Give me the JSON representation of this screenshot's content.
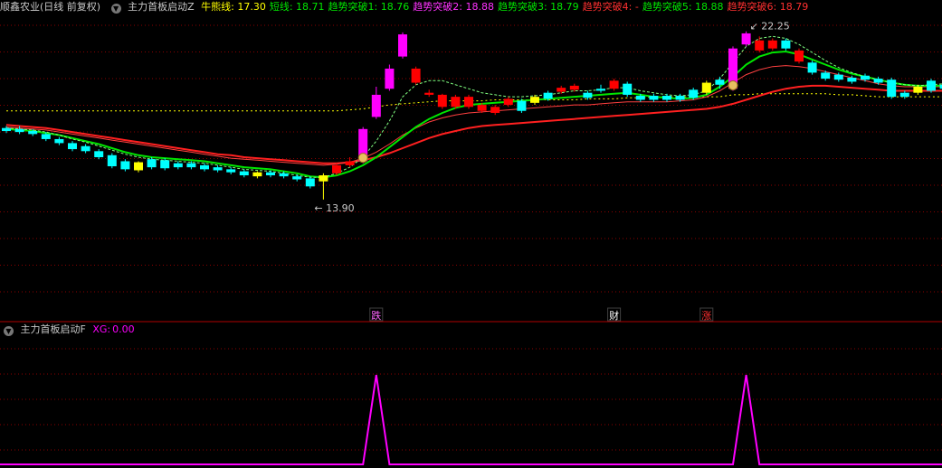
{
  "main_panel": {
    "stock": "顺鑫农业(日线 前复权)",
    "indicator": "主力首板启动Z",
    "values": [
      {
        "label": "牛熊线:",
        "value": "17.30",
        "color": "#ffff00"
      },
      {
        "label": "短线:",
        "value": "18.71",
        "color": "#00e600"
      },
      {
        "label": "趋势突破1:",
        "value": "18.76",
        "color": "#00e600"
      },
      {
        "label": "趋势突破2:",
        "value": "18.88",
        "color": "#ff33ff"
      },
      {
        "label": "趋势突破3:",
        "value": "18.79",
        "color": "#00e600"
      },
      {
        "label": "趋势突破4:",
        "value": "-",
        "color": "#ff3030"
      },
      {
        "label": "趋势突破5:",
        "value": "18.88",
        "color": "#00e600"
      },
      {
        "label": "趋势突破6:",
        "value": "18.79",
        "color": "#ff3030"
      }
    ]
  },
  "sub_panel": {
    "indicator": "主力首板启动F",
    "xg_label": "XG:",
    "xg_value": "0.00"
  },
  "annotations": {
    "low": "13.90",
    "high": "22.25",
    "signals": [
      {
        "text": "跌",
        "bar": 28,
        "color": "#ff66ff"
      },
      {
        "text": "财",
        "bar": 46,
        "color": "#ffffff"
      },
      {
        "text": "涨",
        "bar": 53,
        "color": "#ff3030"
      }
    ]
  },
  "colors": {
    "up_red": "#ff0000",
    "down_cyan": "#00ffff",
    "magenta": "#ff00ff",
    "yellow": "#ffff00",
    "green_line": "#00e600",
    "red_line": "#ff2020",
    "grid": "#8b0000"
  },
  "chart_data": {
    "type": "candlestick",
    "price_range": [
      9.0,
      23.0
    ],
    "candles": [
      {
        "o": 17.45,
        "h": 17.55,
        "c": 17.3,
        "l": 17.2,
        "k": "d"
      },
      {
        "o": 17.4,
        "h": 17.55,
        "c": 17.25,
        "l": 17.15,
        "k": "d"
      },
      {
        "o": 17.3,
        "h": 17.4,
        "c": 17.15,
        "l": 17.05,
        "k": "d"
      },
      {
        "o": 17.15,
        "h": 17.25,
        "c": 16.9,
        "l": 16.8,
        "k": "d"
      },
      {
        "o": 16.9,
        "h": 17.0,
        "c": 16.7,
        "l": 16.6,
        "k": "d"
      },
      {
        "o": 16.7,
        "h": 16.8,
        "c": 16.4,
        "l": 16.3,
        "k": "d"
      },
      {
        "o": 16.55,
        "h": 16.65,
        "c": 16.3,
        "l": 16.2,
        "k": "d"
      },
      {
        "o": 16.3,
        "h": 16.4,
        "c": 16.0,
        "l": 15.9,
        "k": "d"
      },
      {
        "o": 16.1,
        "h": 16.2,
        "c": 15.55,
        "l": 15.45,
        "k": "d"
      },
      {
        "o": 15.8,
        "h": 15.9,
        "c": 15.4,
        "l": 15.3,
        "k": "d"
      },
      {
        "o": 15.35,
        "h": 15.8,
        "c": 15.75,
        "l": 15.25,
        "k": "y"
      },
      {
        "o": 15.9,
        "h": 16.0,
        "c": 15.5,
        "l": 15.4,
        "k": "d"
      },
      {
        "o": 15.85,
        "h": 15.95,
        "c": 15.45,
        "l": 15.35,
        "k": "d"
      },
      {
        "o": 15.7,
        "h": 15.8,
        "c": 15.5,
        "l": 15.4,
        "k": "d"
      },
      {
        "o": 15.7,
        "h": 15.8,
        "c": 15.5,
        "l": 15.4,
        "k": "d"
      },
      {
        "o": 15.6,
        "h": 15.7,
        "c": 15.4,
        "l": 15.3,
        "k": "d"
      },
      {
        "o": 15.5,
        "h": 15.6,
        "c": 15.35,
        "l": 15.25,
        "k": "d"
      },
      {
        "o": 15.4,
        "h": 15.5,
        "c": 15.25,
        "l": 15.15,
        "k": "d"
      },
      {
        "o": 15.3,
        "h": 15.4,
        "c": 15.1,
        "l": 15.0,
        "k": "d"
      },
      {
        "o": 15.05,
        "h": 15.3,
        "c": 15.25,
        "l": 14.95,
        "k": "y"
      },
      {
        "o": 15.25,
        "h": 15.35,
        "c": 15.1,
        "l": 15.0,
        "k": "d"
      },
      {
        "o": 15.2,
        "h": 15.3,
        "c": 15.05,
        "l": 14.95,
        "k": "d"
      },
      {
        "o": 15.05,
        "h": 15.15,
        "c": 14.9,
        "l": 14.8,
        "k": "d"
      },
      {
        "o": 14.95,
        "h": 15.05,
        "c": 14.55,
        "l": 14.45,
        "k": "d"
      },
      {
        "o": 14.8,
        "h": 15.2,
        "c": 15.1,
        "l": 13.9,
        "k": "y"
      },
      {
        "o": 15.2,
        "h": 15.7,
        "c": 15.6,
        "l": 15.1,
        "k": "u"
      },
      {
        "o": 15.6,
        "h": 16.0,
        "c": 15.8,
        "l": 15.5,
        "k": "u"
      },
      {
        "o": 15.8,
        "h": 17.5,
        "c": 17.4,
        "l": 15.7,
        "k": "m"
      },
      {
        "o": 18.0,
        "h": 19.5,
        "c": 19.1,
        "l": 17.9,
        "k": "m"
      },
      {
        "o": 19.4,
        "h": 20.6,
        "c": 20.4,
        "l": 19.3,
        "k": "m"
      },
      {
        "o": 21.0,
        "h": 22.2,
        "c": 22.1,
        "l": 20.9,
        "k": "m"
      },
      {
        "o": 20.4,
        "h": 20.5,
        "c": 19.7,
        "l": 19.6,
        "k": "u"
      },
      {
        "o": 19.2,
        "h": 19.35,
        "c": 19.1,
        "l": 19.0,
        "k": "u"
      },
      {
        "o": 19.1,
        "h": 19.15,
        "c": 18.5,
        "l": 18.4,
        "k": "u"
      },
      {
        "o": 19.0,
        "h": 19.1,
        "c": 18.5,
        "l": 18.4,
        "k": "u"
      },
      {
        "o": 19.0,
        "h": 19.1,
        "c": 18.5,
        "l": 18.4,
        "k": "u"
      },
      {
        "o": 18.6,
        "h": 18.7,
        "c": 18.3,
        "l": 18.2,
        "k": "u"
      },
      {
        "o": 18.5,
        "h": 18.6,
        "c": 18.2,
        "l": 18.1,
        "k": "u"
      },
      {
        "o": 18.9,
        "h": 19.0,
        "c": 18.6,
        "l": 18.5,
        "k": "u"
      },
      {
        "o": 18.3,
        "h": 18.9,
        "c": 18.8,
        "l": 18.2,
        "k": "d"
      },
      {
        "o": 18.7,
        "h": 19.1,
        "c": 19.0,
        "l": 18.6,
        "k": "y"
      },
      {
        "o": 18.9,
        "h": 19.3,
        "c": 19.2,
        "l": 18.8,
        "k": "d"
      },
      {
        "o": 19.45,
        "h": 19.55,
        "c": 19.25,
        "l": 19.15,
        "k": "u"
      },
      {
        "o": 19.55,
        "h": 19.65,
        "c": 19.35,
        "l": 19.25,
        "k": "u"
      },
      {
        "o": 19.2,
        "h": 19.3,
        "c": 18.95,
        "l": 18.85,
        "k": "d"
      },
      {
        "o": 19.4,
        "h": 19.6,
        "c": 19.3,
        "l": 19.2,
        "k": "d"
      },
      {
        "o": 19.8,
        "h": 19.9,
        "c": 19.4,
        "l": 19.3,
        "k": "u"
      },
      {
        "o": 19.65,
        "h": 19.75,
        "c": 19.1,
        "l": 19.0,
        "k": "d"
      },
      {
        "o": 19.05,
        "h": 19.15,
        "c": 18.85,
        "l": 18.75,
        "k": "d"
      },
      {
        "o": 19.05,
        "h": 19.15,
        "c": 18.85,
        "l": 18.75,
        "k": "d"
      },
      {
        "o": 19.05,
        "h": 19.15,
        "c": 18.85,
        "l": 18.75,
        "k": "d"
      },
      {
        "o": 19.05,
        "h": 19.15,
        "c": 18.85,
        "l": 18.75,
        "k": "d"
      },
      {
        "o": 19.35,
        "h": 19.45,
        "c": 18.95,
        "l": 18.85,
        "k": "d"
      },
      {
        "o": 19.2,
        "h": 19.8,
        "c": 19.7,
        "l": 19.1,
        "k": "y"
      },
      {
        "o": 19.6,
        "h": 20.0,
        "c": 19.85,
        "l": 19.4,
        "k": "d"
      },
      {
        "o": 19.4,
        "h": 21.5,
        "c": 21.4,
        "l": 19.3,
        "k": "m"
      },
      {
        "o": 21.6,
        "h": 22.25,
        "c": 22.15,
        "l": 21.5,
        "k": "m"
      },
      {
        "o": 21.8,
        "h": 22.0,
        "c": 21.3,
        "l": 21.2,
        "k": "u"
      },
      {
        "o": 21.4,
        "h": 21.9,
        "c": 21.8,
        "l": 21.3,
        "k": "u"
      },
      {
        "o": 21.8,
        "h": 21.9,
        "c": 21.4,
        "l": 21.3,
        "k": "d"
      },
      {
        "o": 21.3,
        "h": 21.4,
        "c": 20.75,
        "l": 20.65,
        "k": "u"
      },
      {
        "o": 20.7,
        "h": 20.8,
        "c": 20.2,
        "l": 20.1,
        "k": "d"
      },
      {
        "o": 20.2,
        "h": 20.3,
        "c": 19.9,
        "l": 19.8,
        "k": "d"
      },
      {
        "o": 20.1,
        "h": 20.2,
        "c": 19.85,
        "l": 19.75,
        "k": "d"
      },
      {
        "o": 19.95,
        "h": 20.05,
        "c": 19.75,
        "l": 19.65,
        "k": "d"
      },
      {
        "o": 20.05,
        "h": 20.15,
        "c": 19.85,
        "l": 19.75,
        "k": "d"
      },
      {
        "o": 19.9,
        "h": 20.0,
        "c": 19.7,
        "l": 19.6,
        "k": "d"
      },
      {
        "o": 19.85,
        "h": 19.95,
        "c": 19.0,
        "l": 18.9,
        "k": "d"
      },
      {
        "o": 19.2,
        "h": 19.3,
        "c": 19.0,
        "l": 18.9,
        "k": "d"
      },
      {
        "o": 19.2,
        "h": 19.6,
        "c": 19.5,
        "l": 19.1,
        "k": "y"
      },
      {
        "o": 19.8,
        "h": 19.9,
        "c": 19.3,
        "l": 19.2,
        "k": "d"
      },
      {
        "o": 19.6,
        "h": 19.7,
        "c": 19.4,
        "l": 19.3,
        "k": "d"
      },
      {
        "o": 19.6,
        "h": 20.0,
        "c": 19.85,
        "l": 19.4,
        "k": "d"
      }
    ],
    "ma_lines": [
      {
        "name": "牛熊线",
        "color": "#ffff00",
        "style": "dotted",
        "values": [
          18.3,
          18.3,
          18.3,
          18.3,
          18.3,
          18.3,
          18.3,
          18.3,
          18.3,
          18.3,
          18.3,
          18.3,
          18.3,
          18.3,
          18.3,
          18.3,
          18.3,
          18.3,
          18.3,
          18.3,
          18.3,
          18.3,
          18.3,
          18.3,
          18.3,
          18.3,
          18.35,
          18.4,
          18.5,
          18.6,
          18.65,
          18.7,
          18.75,
          18.8,
          18.8,
          18.8,
          18.8,
          18.85,
          18.85,
          18.85,
          18.85,
          18.85,
          18.85,
          18.85,
          18.9,
          18.9,
          18.9,
          18.95,
          18.95,
          19.0,
          19.0,
          19.0,
          19.0,
          19.0,
          19.0,
          19.1,
          19.1,
          19.15,
          19.15,
          19.15,
          19.15,
          19.15,
          19.15,
          19.1,
          19.1,
          19.05,
          19.0,
          19.0,
          19.0,
          19.0,
          19.0,
          19.0,
          19.0
        ]
      },
      {
        "name": "长线",
        "color": "#ff2020",
        "style": "solid",
        "values": [
          17.6,
          17.55,
          17.5,
          17.45,
          17.35,
          17.25,
          17.15,
          17.05,
          16.95,
          16.85,
          16.75,
          16.65,
          16.55,
          16.45,
          16.35,
          16.25,
          16.15,
          16.1,
          16.0,
          15.95,
          15.9,
          15.85,
          15.8,
          15.75,
          15.7,
          15.7,
          15.75,
          15.85,
          16.0,
          16.2,
          16.45,
          16.7,
          16.95,
          17.15,
          17.3,
          17.45,
          17.55,
          17.6,
          17.65,
          17.7,
          17.75,
          17.8,
          17.85,
          17.9,
          17.95,
          18.0,
          18.05,
          18.1,
          18.15,
          18.2,
          18.25,
          18.3,
          18.35,
          18.4,
          18.5,
          18.65,
          18.85,
          19.05,
          19.25,
          19.4,
          19.5,
          19.55,
          19.55,
          19.5,
          19.45,
          19.4,
          19.35,
          19.3,
          19.3,
          19.3,
          19.3,
          19.3,
          19.35
        ]
      },
      {
        "name": "中线",
        "color": "#ff4040",
        "style": "solid",
        "values": [
          17.5,
          17.45,
          17.4,
          17.35,
          17.25,
          17.15,
          17.05,
          16.95,
          16.85,
          16.75,
          16.65,
          16.55,
          16.45,
          16.35,
          16.25,
          16.15,
          16.05,
          15.95,
          15.9,
          15.85,
          15.8,
          15.75,
          15.7,
          15.65,
          15.6,
          15.65,
          15.75,
          15.95,
          16.25,
          16.65,
          17.1,
          17.45,
          17.75,
          17.95,
          18.1,
          18.2,
          18.25,
          18.3,
          18.35,
          18.4,
          18.45,
          18.5,
          18.55,
          18.6,
          18.6,
          18.65,
          18.7,
          18.75,
          18.75,
          18.75,
          18.75,
          18.8,
          18.85,
          19.0,
          19.3,
          19.7,
          20.1,
          20.35,
          20.5,
          20.55,
          20.5,
          20.4,
          20.25,
          20.1,
          19.95,
          19.8,
          19.65,
          19.55,
          19.5,
          19.5,
          19.5,
          19.5,
          19.55
        ]
      },
      {
        "name": "短线",
        "color": "#00e600",
        "style": "solid",
        "values": [
          17.4,
          17.35,
          17.3,
          17.2,
          17.1,
          16.95,
          16.8,
          16.65,
          16.45,
          16.25,
          16.1,
          16.0,
          15.95,
          15.9,
          15.85,
          15.8,
          15.7,
          15.6,
          15.5,
          15.45,
          15.4,
          15.3,
          15.2,
          15.05,
          15.0,
          15.1,
          15.3,
          15.6,
          16.0,
          16.5,
          17.0,
          17.5,
          17.9,
          18.2,
          18.45,
          18.6,
          18.65,
          18.7,
          18.75,
          18.8,
          18.85,
          18.9,
          18.95,
          19.0,
          19.05,
          19.1,
          19.15,
          19.2,
          19.1,
          19.0,
          18.95,
          18.9,
          18.95,
          19.1,
          19.5,
          20.0,
          20.6,
          21.0,
          21.2,
          21.25,
          21.1,
          20.85,
          20.6,
          20.35,
          20.15,
          20.0,
          19.85,
          19.7,
          19.6,
          19.55,
          19.55,
          19.55,
          19.6
        ]
      },
      {
        "name": "趋势线",
        "color": "#80ff80",
        "style": "dashed",
        "values": [
          17.45,
          17.4,
          17.35,
          17.25,
          17.1,
          16.9,
          16.75,
          16.55,
          16.35,
          16.15,
          16.0,
          15.9,
          15.85,
          15.8,
          15.75,
          15.7,
          15.6,
          15.5,
          15.4,
          15.35,
          15.3,
          15.2,
          15.1,
          15.0,
          15.0,
          15.2,
          15.5,
          16.0,
          16.8,
          17.8,
          19.0,
          19.6,
          19.8,
          19.8,
          19.6,
          19.4,
          19.2,
          19.1,
          19.0,
          19.0,
          19.05,
          19.1,
          19.2,
          19.3,
          19.3,
          19.35,
          19.45,
          19.45,
          19.3,
          19.2,
          19.1,
          19.05,
          19.1,
          19.3,
          19.9,
          20.7,
          21.5,
          21.9,
          22.0,
          21.9,
          21.6,
          21.2,
          20.8,
          20.45,
          20.2,
          20.0,
          19.85,
          19.7,
          19.6,
          19.55,
          19.6,
          19.65,
          19.7
        ]
      }
    ],
    "xg_series": {
      "name": "XG",
      "color": "#ff00ff",
      "range": [
        0,
        1
      ],
      "values": [
        0,
        0,
        0,
        0,
        0,
        0,
        0,
        0,
        0,
        0,
        0,
        0,
        0,
        0,
        0,
        0,
        0,
        0,
        0,
        0,
        0,
        0,
        0,
        0,
        0,
        0,
        0,
        0,
        1,
        0,
        0,
        0,
        0,
        0,
        0,
        0,
        0,
        0,
        0,
        0,
        0,
        0,
        0,
        0,
        0,
        0,
        0,
        0,
        0,
        0,
        0,
        0,
        0,
        0,
        0,
        0,
        1,
        0,
        0,
        0,
        0,
        0,
        0,
        0,
        0,
        0,
        0,
        0,
        0,
        0,
        0,
        0,
        0
      ]
    },
    "money_marks": [
      27,
      55
    ]
  }
}
